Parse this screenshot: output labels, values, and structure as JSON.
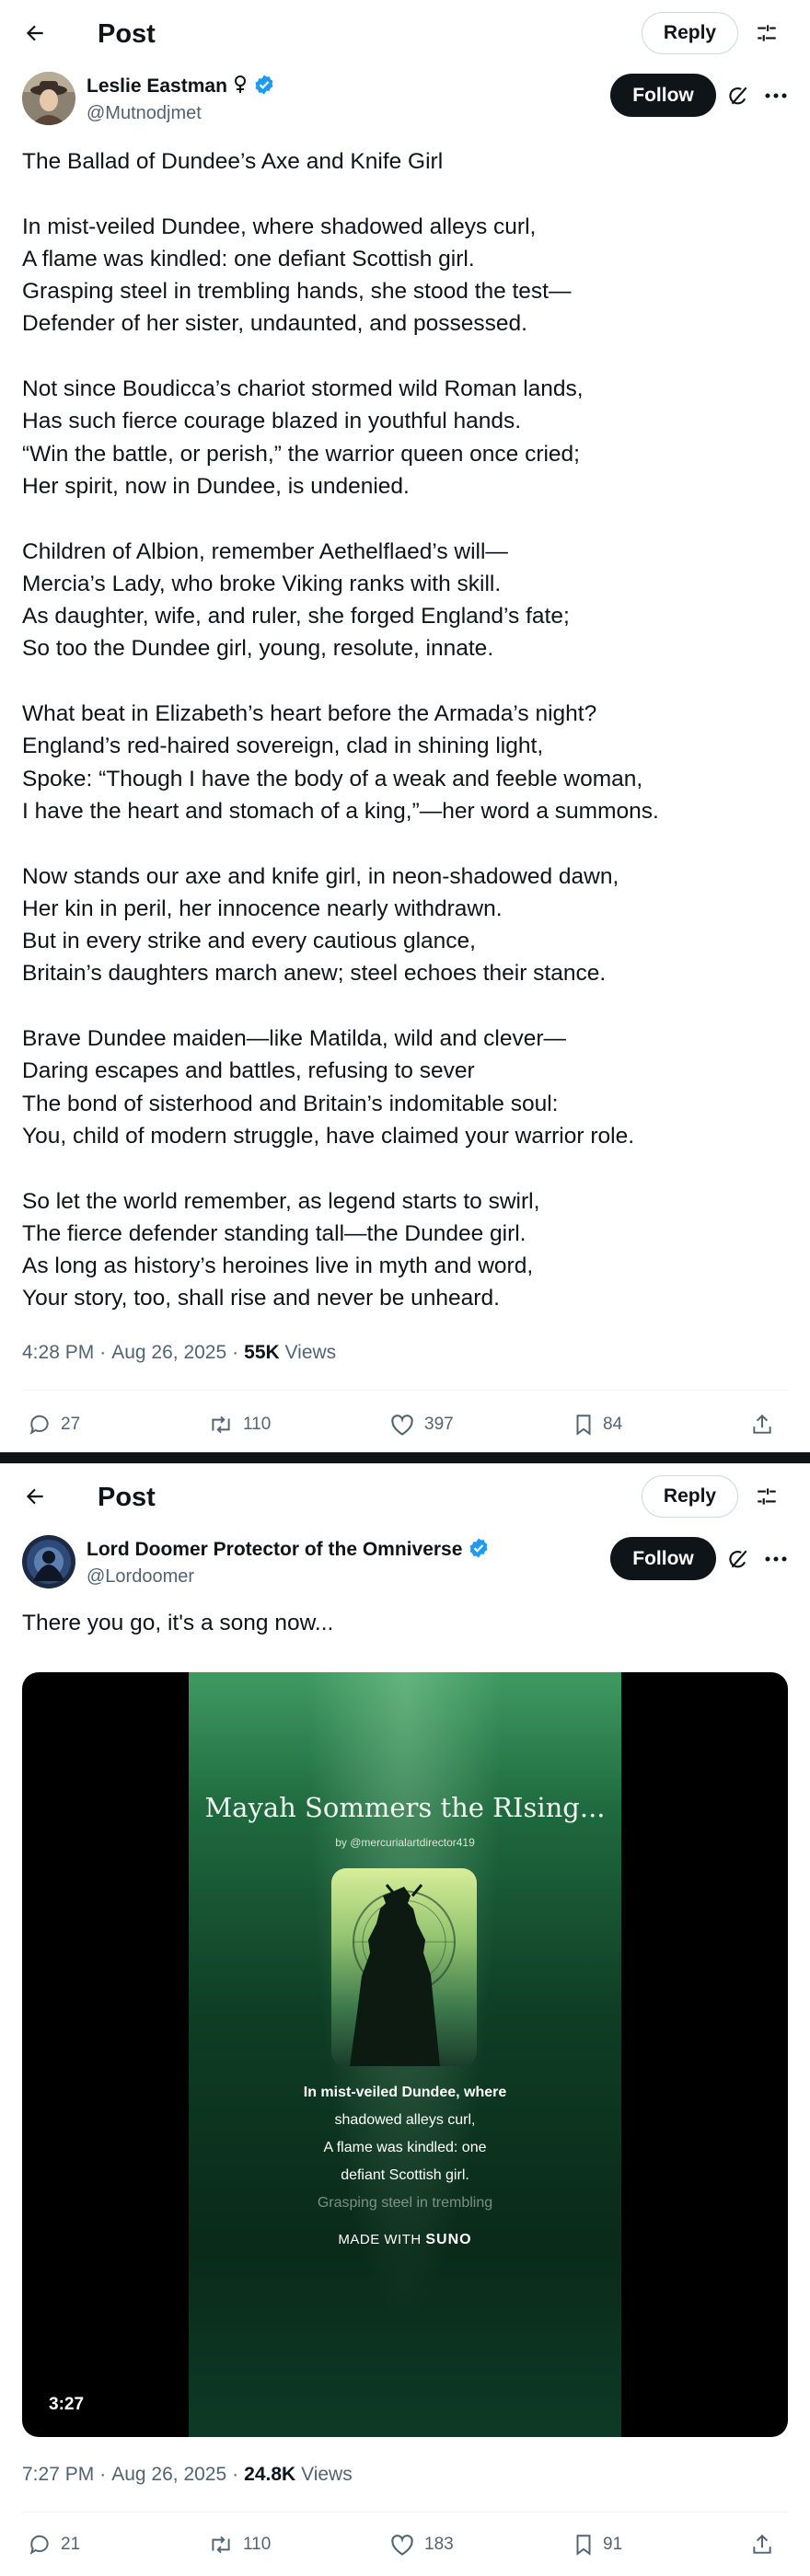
{
  "post1": {
    "topbar": {
      "title": "Post",
      "reply_label": "Reply"
    },
    "author": {
      "name": "Leslie Eastman",
      "handle": "@Mutnodjmet",
      "follow_label": "Follow"
    },
    "body": [
      [
        "The Ballad of Dundee’s Axe and Knife Girl"
      ],
      [
        "In mist-veiled Dundee, where shadowed alleys curl,",
        "A flame was kindled: one defiant Scottish girl.",
        "Grasping steel in trembling hands, she stood the test—",
        "Defender of her sister, undaunted, and possessed."
      ],
      [
        "Not since Boudicca’s chariot stormed wild Roman lands,",
        "Has such fierce courage blazed in youthful hands.",
        "“Win the battle, or perish,” the warrior queen once cried;",
        "Her spirit, now in Dundee, is undenied."
      ],
      [
        "Children of Albion, remember Aethelflaed’s will—",
        "Mercia’s Lady, who broke Viking ranks with skill.",
        "As daughter, wife, and ruler, she forged England’s fate;",
        "So too the Dundee girl, young, resolute, innate."
      ],
      [
        "What beat in Elizabeth’s heart before the Armada’s night?",
        "England’s red-haired sovereign, clad in shining light,",
        "Spoke: “Though I have the body of a weak and feeble woman,",
        "I have the heart and stomach of a king,”—her word a summons."
      ],
      [
        "Now stands our axe and knife girl, in neon-shadowed dawn,",
        "Her kin in peril, her innocence nearly withdrawn.",
        "But in every strike and every cautious glance,",
        "Britain’s daughters march anew; steel echoes their stance."
      ],
      [
        "Brave Dundee maiden—like Matilda, wild and clever—",
        "Daring escapes and battles, refusing to sever",
        "The bond of sisterhood and Britain’s indomitable soul:",
        "You, child of modern struggle, have claimed your warrior role."
      ],
      [
        "So let the world remember, as legend starts to swirl,",
        "The fierce defender standing tall—the Dundee girl.",
        "As long as history’s heroines live in myth and word,",
        "Your story, too, shall rise and never be unheard."
      ]
    ],
    "meta": {
      "time": "4:28 PM",
      "sep": "·",
      "date": "Aug 26, 2025",
      "views_count": "55K",
      "views_label": "Views"
    },
    "actions": {
      "replies": "27",
      "reposts": "110",
      "likes": "397",
      "bookmarks": "84"
    }
  },
  "post2": {
    "topbar": {
      "title": "Post",
      "reply_label": "Reply"
    },
    "author": {
      "name": "Lord Doomer Protector of the Omniverse",
      "handle": "@Lordoomer",
      "follow_label": "Follow"
    },
    "body_text": "There you go, it's a song now...",
    "media": {
      "song_title": "Mayah Sommers the RIsing...",
      "song_by": "by @mercurialartdirector419",
      "lyrics": [
        "In mist-veiled Dundee, where",
        "shadowed alleys curl,",
        "A flame was kindled: one",
        "defiant Scottish girl.",
        "Grasping steel in trembling"
      ],
      "made_with": "MADE WITH",
      "brand": "SUNO",
      "duration": "3:27"
    },
    "meta": {
      "time": "7:27 PM",
      "sep": "·",
      "date": "Aug 26, 2025",
      "views_count": "24.8K",
      "views_label": "Views"
    },
    "actions": {
      "replies": "21",
      "reposts": "110",
      "likes": "183",
      "bookmarks": "91"
    }
  },
  "colors": {
    "verified": "#1d9bf0",
    "text": "#0f1419",
    "muted": "#536471",
    "border": "#cfd9de"
  }
}
